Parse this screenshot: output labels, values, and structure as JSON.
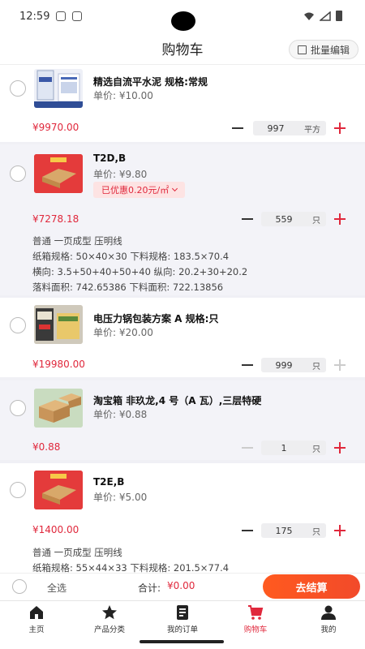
{
  "status": {
    "time": "12:59"
  },
  "header": {
    "title": "购物车",
    "batch_edit_label": "批量编辑"
  },
  "items": [
    {
      "name": "精选自流平水泥 规格:常规",
      "unit_price": "单价: ¥10.00",
      "subtotal": "¥9970.00",
      "quantity": "997",
      "unit": "平方",
      "selected": false
    },
    {
      "name": "T2D,B",
      "unit_price": "单价: ¥9.80",
      "discount": "已优惠0.20元/㎡",
      "subtotal": "¥7278.18",
      "quantity": "559",
      "unit": "只",
      "specs": [
        "普通 一页成型 压明线",
        "纸箱规格: 50×40×30 下料规格: 183.5×70.4",
        "横向: 3.5+50+40+50+40 纵向: 20.2+30+20.2",
        "落料面积: 742.65386 下料面积: 722.13856"
      ],
      "selected": false
    },
    {
      "name": "电压力锅包装方案 A 规格:只",
      "unit_price": "单价: ¥20.00",
      "subtotal": "¥19980.00",
      "quantity": "999",
      "unit": "只",
      "selected": false
    },
    {
      "name": "淘宝箱 非玖龙,4 号（A 瓦）,三层特硬",
      "unit_price": "单价: ¥0.88",
      "subtotal": "¥0.88",
      "quantity": "1",
      "unit": "只",
      "selected": false
    },
    {
      "name": "T2E,B",
      "unit_price": "单价: ¥5.00",
      "subtotal": "¥1400.00",
      "quantity": "175",
      "unit": "只",
      "specs": [
        "普通 一页成型 压明线",
        "纸箱规格: 55×44×33 下料规格: 201.5×77.4"
      ],
      "selected": false
    }
  ],
  "footer": {
    "select_all": "全选",
    "total_label": "合计:",
    "total_value": "¥0.00",
    "checkout": "去结算"
  },
  "tabs": [
    {
      "label": "主页",
      "icon": "home-icon"
    },
    {
      "label": "产品分类",
      "icon": "star-icon"
    },
    {
      "label": "我的订单",
      "icon": "orders-icon"
    },
    {
      "label": "购物车",
      "icon": "cart-icon",
      "active": true
    },
    {
      "label": "我的",
      "icon": "person-icon"
    }
  ],
  "colors": {
    "accent": "#e0283c",
    "checkout": "#ff5a1f"
  }
}
